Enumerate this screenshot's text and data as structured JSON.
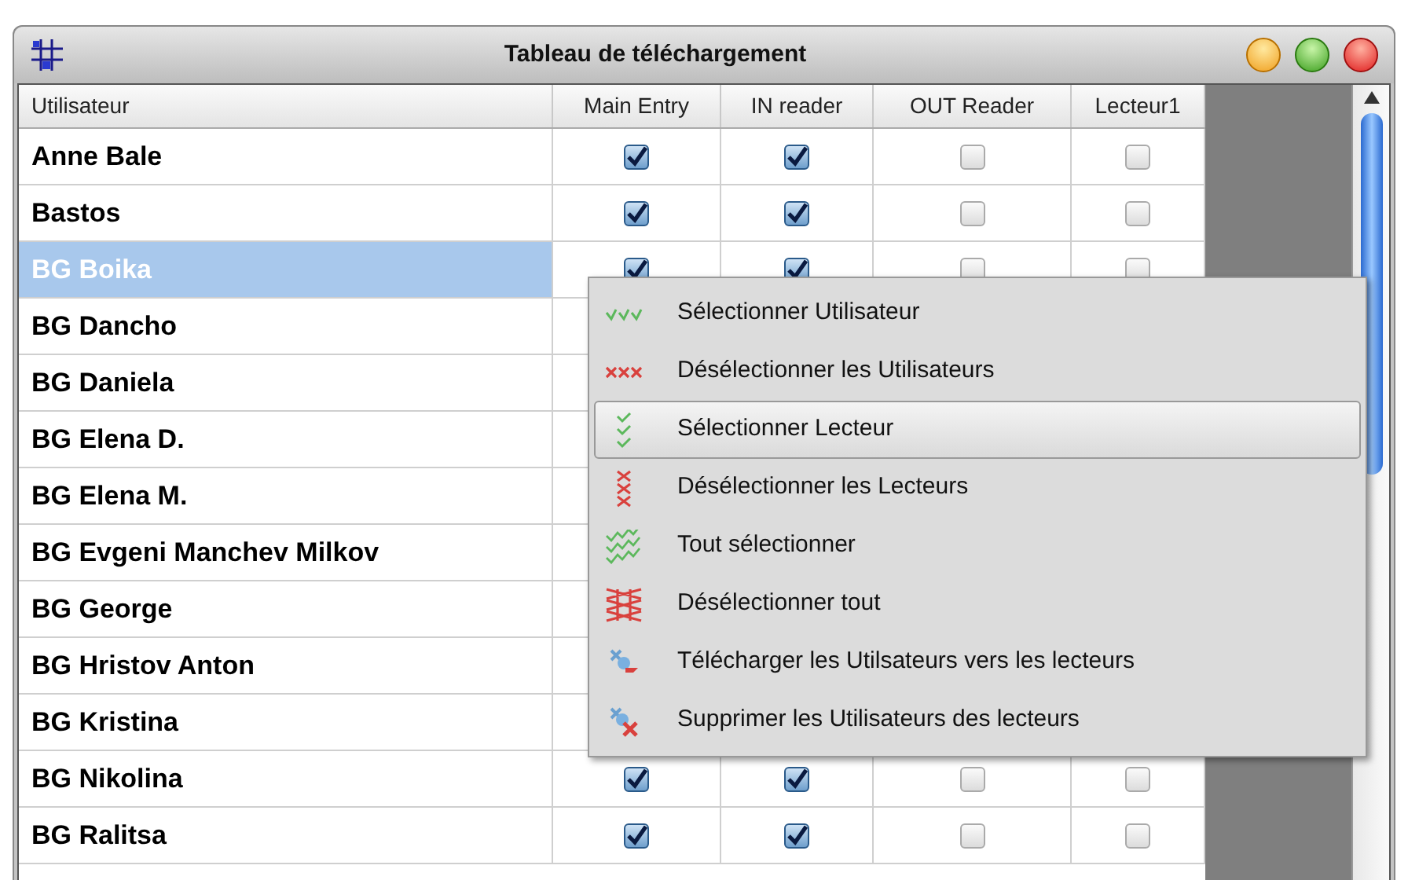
{
  "window": {
    "title": "Tableau de téléchargement"
  },
  "table": {
    "columns": [
      "Utilisateur",
      "Main Entry",
      "IN reader",
      "OUT Reader",
      "Lecteur1"
    ],
    "rows": [
      {
        "name": "Anne Bale",
        "selected": false,
        "checks": [
          true,
          true,
          false,
          false
        ]
      },
      {
        "name": "Bastos",
        "selected": false,
        "checks": [
          true,
          true,
          false,
          false
        ]
      },
      {
        "name": "BG Boika",
        "selected": true,
        "checks": [
          true,
          true,
          false,
          false
        ]
      },
      {
        "name": "BG Dancho",
        "selected": false
      },
      {
        "name": "BG Daniela",
        "selected": false
      },
      {
        "name": "BG Elena D.",
        "selected": false
      },
      {
        "name": "BG Elena M.",
        "selected": false
      },
      {
        "name": "BG Evgeni Manchev Milkov",
        "selected": false
      },
      {
        "name": "BG George",
        "selected": false
      },
      {
        "name": "BG Hristov Anton",
        "selected": false
      },
      {
        "name": "BG Kristina",
        "selected": false
      },
      {
        "name": "BG Nikolina",
        "selected": false,
        "checks": [
          true,
          true,
          false,
          false
        ]
      },
      {
        "name": "BG Ralitsa",
        "selected": false,
        "checks": [
          true,
          true,
          false,
          false
        ]
      }
    ]
  },
  "context_menu": {
    "items": [
      {
        "label": "Sélectionner Utilisateur",
        "selected": false
      },
      {
        "label": "Désélectionner les Utilisateurs",
        "selected": false
      },
      {
        "label": "Sélectionner Lecteur",
        "selected": true
      },
      {
        "label": "Désélectionner les Lecteurs",
        "selected": false
      },
      {
        "label": "Tout sélectionner",
        "selected": false
      },
      {
        "label": "Désélectionner tout",
        "selected": false
      },
      {
        "label": "Télécharger les Utilsateurs vers les lecteurs",
        "selected": false
      },
      {
        "label": "Supprimer les Utilisateurs des lecteurs",
        "selected": false
      }
    ]
  }
}
